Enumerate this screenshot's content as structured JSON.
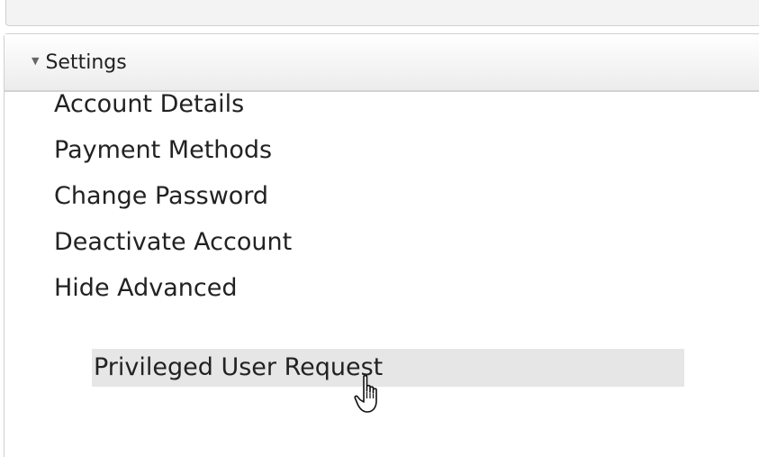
{
  "settings": {
    "header_label": "Settings",
    "caret_icon": "caret-down-icon",
    "items": [
      {
        "label": "Account Details"
      },
      {
        "label": "Payment Methods"
      },
      {
        "label": "Change Password"
      },
      {
        "label": "Deactivate Account"
      },
      {
        "label": "Hide Advanced"
      }
    ],
    "sub_items": [
      {
        "label": "Privileged User Request",
        "highlighted": true
      }
    ]
  },
  "cursor": {
    "icon": "hand-pointer-icon"
  },
  "colors": {
    "highlight": "#e6e6e6",
    "text": "#222222",
    "border": "#d0d0d0"
  }
}
